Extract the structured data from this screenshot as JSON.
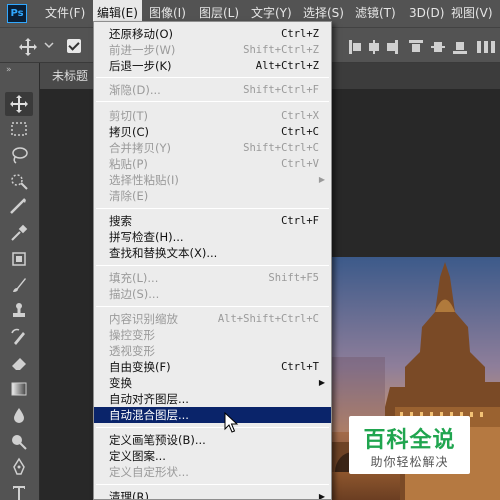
{
  "menubar": {
    "items": [
      {
        "label": "文件(F)"
      },
      {
        "label": "编辑(E)"
      },
      {
        "label": "图像(I)"
      },
      {
        "label": "图层(L)"
      },
      {
        "label": "文字(Y)"
      },
      {
        "label": "选择(S)"
      },
      {
        "label": "滤镜(T)"
      },
      {
        "label": "3D(D)"
      },
      {
        "label": "视图(V)"
      }
    ],
    "logo": "Ps"
  },
  "toolbar": {
    "collapse": "»"
  },
  "document": {
    "tab_label": "未标题"
  },
  "edit_menu": {
    "items": [
      {
        "label": "还原移动(O)",
        "shortcut": "Ctrl+Z"
      },
      {
        "label": "前进一步(W)",
        "shortcut": "Shift+Ctrl+Z"
      },
      {
        "label": "后退一步(K)",
        "shortcut": "Alt+Ctrl+Z"
      },
      {
        "label": "渐隐(D)...",
        "shortcut": "Shift+Ctrl+F"
      },
      {
        "label": "剪切(T)",
        "shortcut": "Ctrl+X"
      },
      {
        "label": "拷贝(C)",
        "shortcut": "Ctrl+C"
      },
      {
        "label": "合并拷贝(Y)",
        "shortcut": "Shift+Ctrl+C"
      },
      {
        "label": "粘贴(P)",
        "shortcut": "Ctrl+V"
      },
      {
        "label": "选择性粘贴(I)",
        "shortcut": ""
      },
      {
        "label": "清除(E)",
        "shortcut": ""
      },
      {
        "label": "搜索",
        "shortcut": "Ctrl+F"
      },
      {
        "label": "拼写检查(H)...",
        "shortcut": ""
      },
      {
        "label": "查找和替换文本(X)...",
        "shortcut": ""
      },
      {
        "label": "填充(L)...",
        "shortcut": "Shift+F5"
      },
      {
        "label": "描边(S)...",
        "shortcut": ""
      },
      {
        "label": "内容识别缩放",
        "shortcut": "Alt+Shift+Ctrl+C"
      },
      {
        "label": "操控变形",
        "shortcut": ""
      },
      {
        "label": "透视变形",
        "shortcut": ""
      },
      {
        "label": "自由变换(F)",
        "shortcut": "Ctrl+T"
      },
      {
        "label": "变换",
        "shortcut": ""
      },
      {
        "label": "自动对齐图层...",
        "shortcut": ""
      },
      {
        "label": "自动混合图层...",
        "shortcut": ""
      },
      {
        "label": "定义画笔预设(B)...",
        "shortcut": ""
      },
      {
        "label": "定义图案...",
        "shortcut": ""
      },
      {
        "label": "定义自定形状...",
        "shortcut": ""
      },
      {
        "label": "清理(R)",
        "shortcut": ""
      }
    ]
  },
  "watermark": {
    "title": "百科全说",
    "subtitle": "助你轻松解决"
  },
  "colors": {
    "highlight": "#0a246a",
    "ps_blue": "#31a8ff",
    "watermark_green": "#20a54f"
  },
  "icons": [
    "ps-logo-icon",
    "move-icon",
    "marquee-icon",
    "lasso-icon",
    "quick-select-icon",
    "crop-icon",
    "eyedropper-icon",
    "frame-icon",
    "brush-icon",
    "stamp-icon",
    "history-brush-icon",
    "eraser-icon",
    "gradient-icon",
    "blur-icon",
    "dodge-icon",
    "pen-icon",
    "type-icon",
    "cursor-icon",
    "submenu-arrow-icon"
  ]
}
